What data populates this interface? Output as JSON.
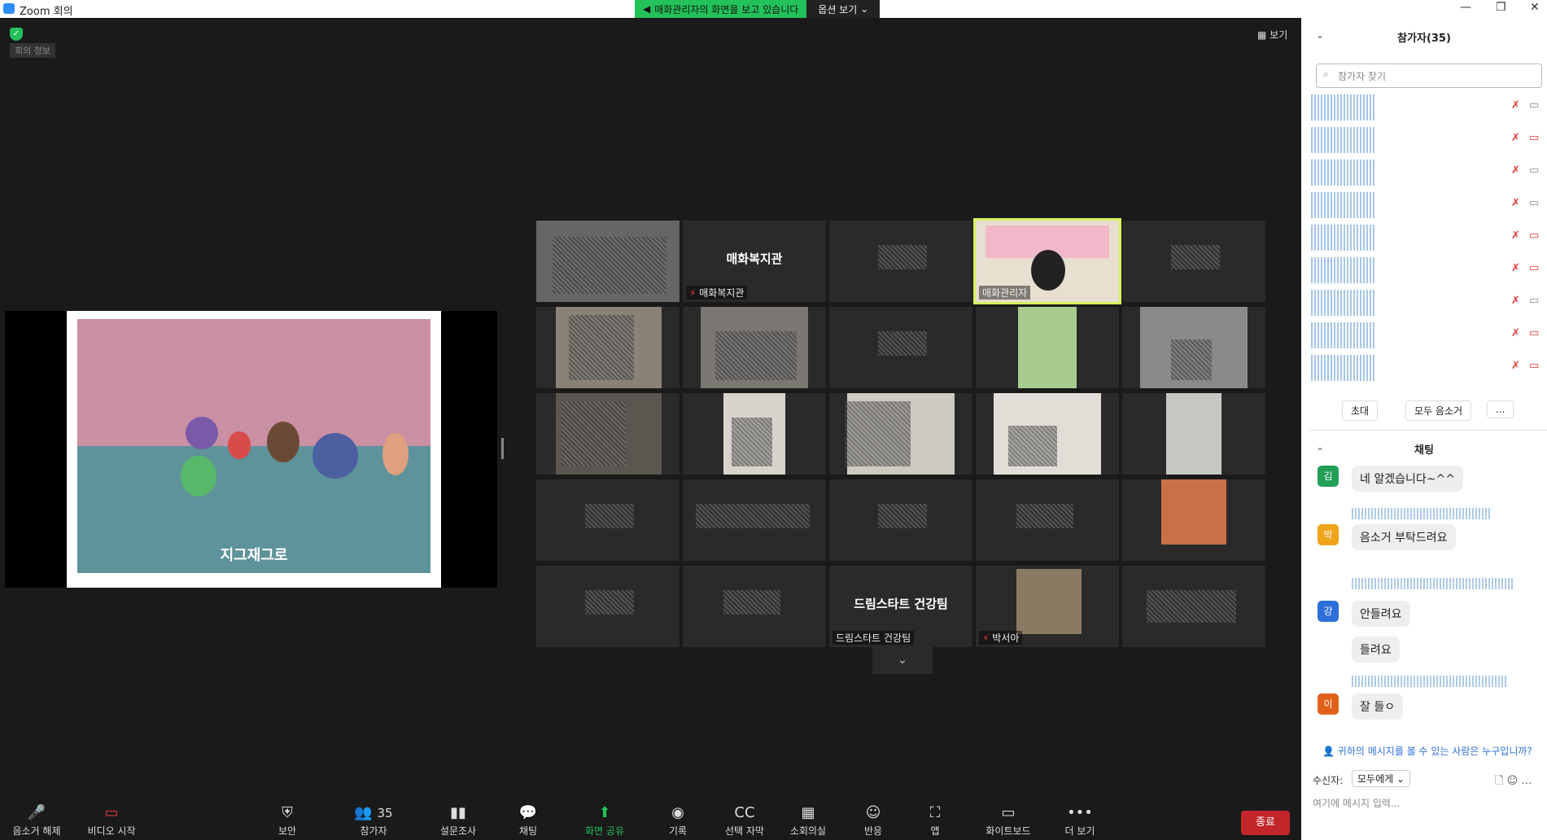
{
  "window": {
    "title": "Zoom 회의",
    "minimize": "—",
    "maximize": "❐",
    "close": "✕"
  },
  "banner": {
    "viewing": "매화관리자의 화면을 보고 있습니다",
    "options": "옵션 보기"
  },
  "main": {
    "meeting_info": "회의 정보",
    "view": "보기",
    "shared_caption": "지그재그로"
  },
  "tiles": [
    {
      "name": "",
      "center": ""
    },
    {
      "name": "매화복지관",
      "center": "매화복지관"
    },
    {
      "name": "",
      "center": ""
    },
    {
      "name": "매화관리자",
      "center": ""
    },
    {
      "name": "",
      "center": ""
    },
    {
      "name": "",
      "center": ""
    },
    {
      "name": "",
      "center": ""
    },
    {
      "name": "",
      "center": ""
    },
    {
      "name": "",
      "center": ""
    },
    {
      "name": "",
      "center": ""
    },
    {
      "name": "",
      "center": ""
    },
    {
      "name": "",
      "center": ""
    },
    {
      "name": "",
      "center": ""
    },
    {
      "name": "",
      "center": ""
    },
    {
      "name": "",
      "center": ""
    },
    {
      "name": "",
      "center": ""
    },
    {
      "name": "",
      "center": ""
    },
    {
      "name": "",
      "center": ""
    },
    {
      "name": "",
      "center": ""
    },
    {
      "name": "",
      "center": ""
    },
    {
      "name": "",
      "center": ""
    },
    {
      "name": "",
      "center": ""
    },
    {
      "name": "드림스타트 건강팀",
      "center": "드림스타트 건강팀"
    },
    {
      "name": "박서아",
      "center": ""
    },
    {
      "name": "",
      "center": ""
    }
  ],
  "toolbar": {
    "unmute": "음소거 해제",
    "start_video": "비디오 시작",
    "security": "보안",
    "participants": "참가자",
    "participants_count": "35",
    "polls": "설문조사",
    "chat": "채팅",
    "share": "화면 공유",
    "record": "기록",
    "captions": "선택 자막",
    "breakout": "소회의실",
    "reactions": "반응",
    "apps": "앱",
    "whiteboard": "화이트보드",
    "more": "더 보기",
    "end": "종료"
  },
  "panel": {
    "participants_header": "참가자(35)",
    "search_placeholder": "참가자 찾기",
    "invite": "초대",
    "mute_all": "모두 음소거",
    "more": "...",
    "chat_header": "채팅",
    "who_can_see": "귀하의 메시지를 볼 수 있는 사람은 누구입니까?",
    "recipient_label": "수신자:",
    "recipient_value": "모두에게",
    "input_placeholder": "여기에 메시지 입력..."
  },
  "chat_messages": [
    {
      "avatar": "김",
      "color": "#23a058",
      "text": "네 알겠습니다~^^"
    },
    {
      "avatar": "박",
      "color": "#f0a41c",
      "text": "음소거 부탁드려요"
    },
    {
      "avatar": "강",
      "color": "#2d6fd8",
      "text": "안들려요"
    },
    {
      "avatar": "",
      "color": "",
      "text": "들려요"
    },
    {
      "avatar": "이",
      "color": "#e0621a",
      "text": "잘 들ㅇ"
    }
  ]
}
